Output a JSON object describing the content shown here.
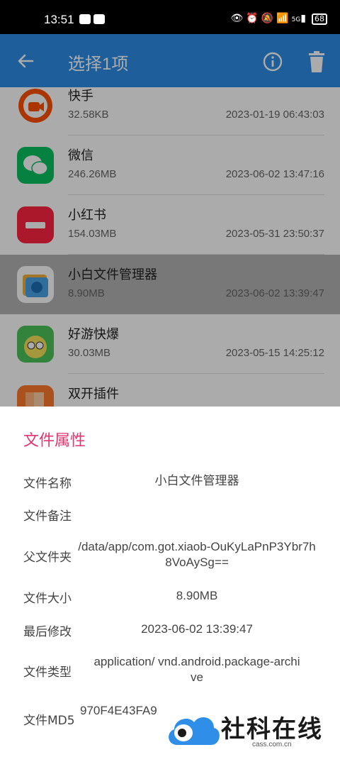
{
  "status_bar": {
    "time": "13:51",
    "battery": "68",
    "network": "5G"
  },
  "app_bar": {
    "title": "选择1项"
  },
  "files": [
    {
      "name": "快手",
      "size": "32.58KB",
      "date": "2023-01-19 06:43:03",
      "icon": "kuaishou-icon",
      "color": "#ff5000"
    },
    {
      "name": "微信",
      "size": "246.26MB",
      "date": "2023-06-02 13:47:16",
      "icon": "wechat-icon",
      "color": "#09c160"
    },
    {
      "name": "小红书",
      "size": "154.03MB",
      "date": "2023-05-31 23:50:37",
      "icon": "xiaohongshu-icon",
      "color": "#ff2442"
    },
    {
      "name": "小白文件管理器",
      "size": "8.90MB",
      "date": "2023-06-02 13:39:47",
      "icon": "file-manager-icon",
      "color": "#4aa3e8"
    },
    {
      "name": "好游快爆",
      "size": "30.03MB",
      "date": "2023-05-15 14:25:12",
      "icon": "haoyou-icon",
      "color": "#4cc35c"
    },
    {
      "name": "双开插件",
      "size": "",
      "date": "",
      "icon": "dual-app-icon",
      "color": "#ff7a2e"
    }
  ],
  "properties": {
    "title": "文件属性",
    "items": [
      {
        "label": "文件名称",
        "value": "小白文件管理器"
      },
      {
        "label": "文件备注",
        "value": ""
      },
      {
        "label": "父文件夹",
        "value": "/data/app/com.got.xiaob-OuKyLaPnP3Ybr7h8VoAySg=="
      },
      {
        "label": "文件大小",
        "value": "8.90MB"
      },
      {
        "label": "最后修改",
        "value": "2023-06-02 13:39:47"
      },
      {
        "label": "文件类型",
        "value": "application/ vnd.android.package-archive"
      },
      {
        "label": "文件MD5",
        "value": "970F4E43FA9"
      }
    ]
  },
  "watermark": {
    "text": "社科在线",
    "sub": "cass.com.cn"
  },
  "colors": {
    "accent": "#2e8ee8",
    "title_pink": "#e0356d"
  }
}
